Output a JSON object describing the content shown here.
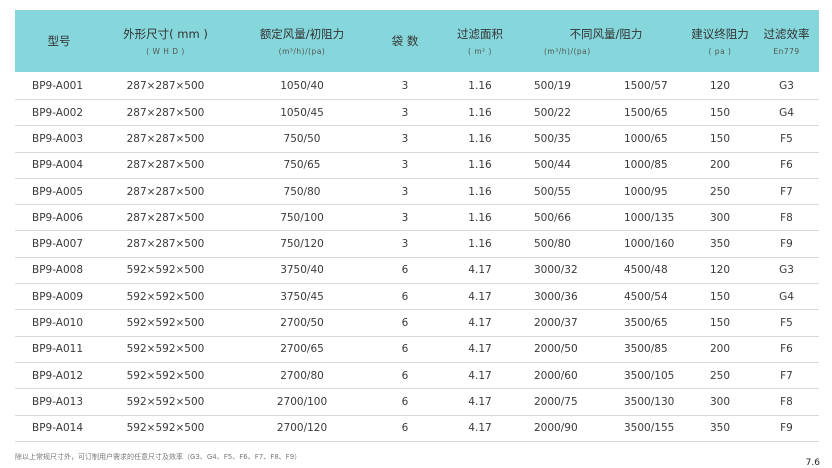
{
  "table": {
    "headers": {
      "model": "型号",
      "size": "外形尺寸( mm )",
      "size_sub": "( W H D )",
      "rated": "额定风量/初阻力",
      "rated_sub": "(m³/h)/(pa)",
      "bags": "袋 数",
      "area": "过滤面积",
      "area_sub": "( m² )",
      "diff": "不同风量/阻力",
      "diff_sub": "(m³/h)/(pa)",
      "final": "建议终阻力",
      "final_sub": "( pa )",
      "eff": "过滤效率",
      "eff_sub": "En779"
    },
    "rows": [
      {
        "model": "BP9-A001",
        "size": "287×287×500",
        "rated": "1050/40",
        "bags": "3",
        "area": "1.16",
        "d1": "500/19",
        "d2": "1500/57",
        "final": "120",
        "eff": "G3"
      },
      {
        "model": "BP9-A002",
        "size": "287×287×500",
        "rated": "1050/45",
        "bags": "3",
        "area": "1.16",
        "d1": "500/22",
        "d2": "1500/65",
        "final": "150",
        "eff": "G4"
      },
      {
        "model": "BP9-A003",
        "size": "287×287×500",
        "rated": "750/50",
        "bags": "3",
        "area": "1.16",
        "d1": "500/35",
        "d2": "1000/65",
        "final": "150",
        "eff": "F5"
      },
      {
        "model": "BP9-A004",
        "size": "287×287×500",
        "rated": "750/65",
        "bags": "3",
        "area": "1.16",
        "d1": "500/44",
        "d2": "1000/85",
        "final": "200",
        "eff": "F6"
      },
      {
        "model": "BP9-A005",
        "size": "287×287×500",
        "rated": "750/80",
        "bags": "3",
        "area": "1.16",
        "d1": "500/55",
        "d2": "1000/95",
        "final": "250",
        "eff": "F7"
      },
      {
        "model": "BP9-A006",
        "size": "287×287×500",
        "rated": "750/100",
        "bags": "3",
        "area": "1.16",
        "d1": "500/66",
        "d2": "1000/135",
        "final": "300",
        "eff": "F8"
      },
      {
        "model": "BP9-A007",
        "size": "287×287×500",
        "rated": "750/120",
        "bags": "3",
        "area": "1.16",
        "d1": "500/80",
        "d2": "1000/160",
        "final": "350",
        "eff": "F9"
      },
      {
        "model": "BP9-A008",
        "size": "592×592×500",
        "rated": "3750/40",
        "bags": "6",
        "area": "4.17",
        "d1": "3000/32",
        "d2": "4500/48",
        "final": "120",
        "eff": "G3"
      },
      {
        "model": "BP9-A009",
        "size": "592×592×500",
        "rated": "3750/45",
        "bags": "6",
        "area": "4.17",
        "d1": "3000/36",
        "d2": "4500/54",
        "final": "150",
        "eff": "G4"
      },
      {
        "model": "BP9-A010",
        "size": "592×592×500",
        "rated": "2700/50",
        "bags": "6",
        "area": "4.17",
        "d1": "2000/37",
        "d2": "3500/65",
        "final": "150",
        "eff": "F5"
      },
      {
        "model": "BP9-A011",
        "size": "592×592×500",
        "rated": "2700/65",
        "bags": "6",
        "area": "4.17",
        "d1": "2000/50",
        "d2": "3500/85",
        "final": "200",
        "eff": "F6"
      },
      {
        "model": "BP9-A012",
        "size": "592×592×500",
        "rated": "2700/80",
        "bags": "6",
        "area": "4.17",
        "d1": "2000/60",
        "d2": "3500/105",
        "final": "250",
        "eff": "F7"
      },
      {
        "model": "BP9-A013",
        "size": "592×592×500",
        "rated": "2700/100",
        "bags": "6",
        "area": "4.17",
        "d1": "2000/75",
        "d2": "3500/130",
        "final": "300",
        "eff": "F8"
      },
      {
        "model": "BP9-A014",
        "size": "592×592×500",
        "rated": "2700/120",
        "bags": "6",
        "area": "4.17",
        "d1": "2000/90",
        "d2": "3500/155",
        "final": "350",
        "eff": "F9"
      }
    ]
  },
  "footnote": "除以上常规尺寸外，可订制用户需求的任意尺寸及效率（G3、G4、F5、F6、F7、F8、F9）",
  "corner_mark": "7.6"
}
